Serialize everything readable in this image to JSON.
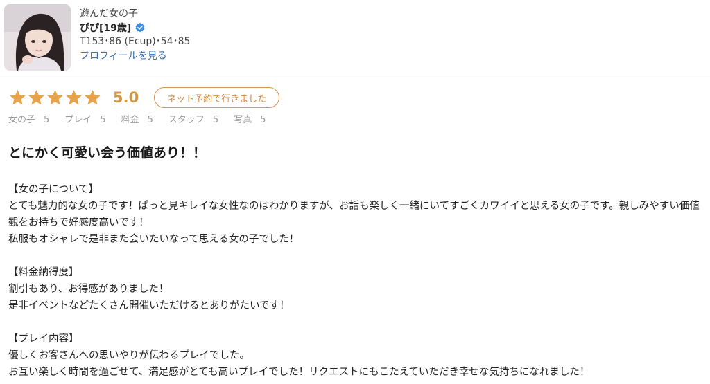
{
  "header": {
    "label": "遊んだ女の子",
    "name": "ぴぴ[19歳]",
    "stats": "T153･86 (Ecup)･54･85",
    "profile_link": "プロフィールを見る"
  },
  "rating": {
    "stars": 5,
    "score": "5.0",
    "badge": "ネット予約で行きました"
  },
  "subscores": [
    {
      "label": "女の子",
      "value": "5"
    },
    {
      "label": "プレイ",
      "value": "5"
    },
    {
      "label": "料金",
      "value": "5"
    },
    {
      "label": "スタッフ",
      "value": "5"
    },
    {
      "label": "写真",
      "value": "5"
    }
  ],
  "review": {
    "title": "とにかく可愛い会う価値あり！！",
    "sections": [
      {
        "heading": "【女の子について】",
        "lines": [
          "とても魅力的な女の子です！ぱっと見キレイな女性なのはわかりますが、お話も楽しく一緒にいてすごくカワイイと思える女の子です。親しみやすい価値観をお持ちで好感度高いです！",
          "私服もオシャレで是非また会いたいなって思える女の子でした！"
        ]
      },
      {
        "heading": "【料金納得度】",
        "lines": [
          "割引もあり、お得感がありました！",
          "是非イベントなどたくさん開催いただけるとありがたいです！"
        ]
      },
      {
        "heading": "【プレイ内容】",
        "lines": [
          "優しくお客さんへの思いやりが伝わるプレイでした。",
          "お互い楽しく時間を過ごせて、満足感がとても高いプレイでした！リクエストにもこたえていただき幸せな気持ちになれました！"
        ]
      }
    ]
  },
  "colors": {
    "star": "#e8a24a",
    "score": "#d4963e",
    "badge_border": "#d49550",
    "link": "#3a6fb0",
    "verified": "#3d8fe0"
  }
}
